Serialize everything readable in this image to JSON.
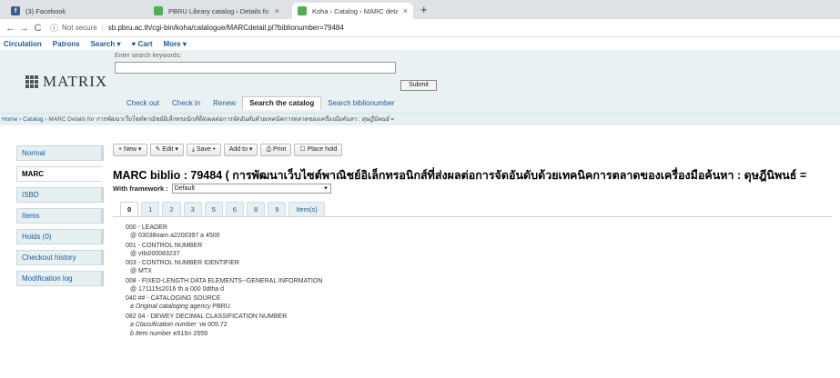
{
  "browser": {
    "tabs": [
      {
        "title": "(3) Facebook",
        "icon": "facebook-icon",
        "color": "#3b5998",
        "active": false
      },
      {
        "title": "PBRU Library catalog › Details fo",
        "icon": "koha-icon",
        "color": "#4caf50",
        "active": false
      },
      {
        "title": "Koha › Catalog › MARC details fo",
        "icon": "koha-icon",
        "color": "#4caf50",
        "active": true
      }
    ],
    "new_tab": "+",
    "security": "Not secure",
    "url": "sb.pbru.ac.th/cgi-bin/koha/catalogue/MARCdetail.pl?biblionumber=79484"
  },
  "koha_nav": [
    "Circulation",
    "Patrons",
    "Search ▾",
    "♥ Cart",
    "More ▾"
  ],
  "header": {
    "logo_text": "MATRIX",
    "search_label": "Enter search keywords:",
    "search_value": "",
    "submit_label": "Submit",
    "tabs": [
      {
        "label": "Check out",
        "active": false
      },
      {
        "label": "Check in",
        "active": false
      },
      {
        "label": "Renew",
        "active": false
      },
      {
        "label": "Search the catalog",
        "active": true
      },
      {
        "label": "Search biblionumber",
        "active": false
      }
    ]
  },
  "breadcrumb": {
    "home": "Home",
    "catalog": "Catalog",
    "current_prefix": "MARC Details for",
    "current_title": "การพัฒนาเว็บไซต์พาณิชย์อิเล็กทรอนิกส์ที่ส่งผลต่อการจัดอันดับด้วยเทคนิคการตลาดของเครื่องมือค้นหา : ดุษฎีนิพนธ์ ="
  },
  "sidebar": [
    {
      "label": "Normal",
      "active": false
    },
    {
      "label": "MARC",
      "active": true
    },
    {
      "label": "ISBD",
      "active": false
    },
    {
      "label": "Items",
      "active": false
    },
    {
      "label": "Holds (0)",
      "active": false
    },
    {
      "label": "Checkout history",
      "active": false
    },
    {
      "label": "Modification log",
      "active": false
    }
  ],
  "toolbar": [
    "+ New ▾",
    "✎ Edit ▾",
    "⤓ Save ▾",
    "Add to ▾",
    "⎙ Print",
    "☐ Place hold"
  ],
  "page_title": "MARC biblio : 79484 ( การพัฒนาเว็บไซต์พาณิชย์อิเล็กทรอนิกส์ที่ส่งผลต่อการจัดอันดับด้วยเทคนิคการตลาดของเครื่องมือค้นหา : ดุษฎีนิพนธ์ =",
  "framework": {
    "label": "With framework :",
    "value": "Default"
  },
  "marc_tabs": [
    {
      "label": "0",
      "active": true
    },
    {
      "label": "1",
      "active": false
    },
    {
      "label": "2",
      "active": false
    },
    {
      "label": "3",
      "active": false
    },
    {
      "label": "5",
      "active": false
    },
    {
      "label": "6",
      "active": false
    },
    {
      "label": "8",
      "active": false
    },
    {
      "label": "9",
      "active": false
    },
    {
      "label": "Item(s)",
      "active": false
    }
  ],
  "fields": [
    {
      "tag": "000 - LEADER",
      "subs": [
        {
          "code": "",
          "text": "@ 03038nam a2200397 a 4500"
        }
      ]
    },
    {
      "tag": "001 - CONTROL NUMBER",
      "subs": [
        {
          "code": "",
          "text": "@ vtls000083237"
        }
      ]
    },
    {
      "tag": "003 - CONTROL NUMBER IDENTIFIER",
      "subs": [
        {
          "code": "",
          "text": "@ MTX"
        }
      ]
    },
    {
      "tag": "008 - FIXED-LENGTH DATA ELEMENTS--GENERAL INFORMATION",
      "subs": [
        {
          "code": "",
          "text": "@ 171115s2016 th a 000 0dtha d"
        }
      ]
    },
    {
      "tag": "040 ## - CATALOGING SOURCE",
      "subs": [
        {
          "code": "a Original cataloging agency",
          "text": "PBRU"
        }
      ]
    },
    {
      "tag": "082 04 - DEWEY DECIMAL CLASSIFICATION NUMBER",
      "subs": [
        {
          "code": "a Classification number",
          "text": "วพ 005.72"
        },
        {
          "code": "b Item number",
          "text": "ด519ก 2559"
        }
      ]
    }
  ]
}
